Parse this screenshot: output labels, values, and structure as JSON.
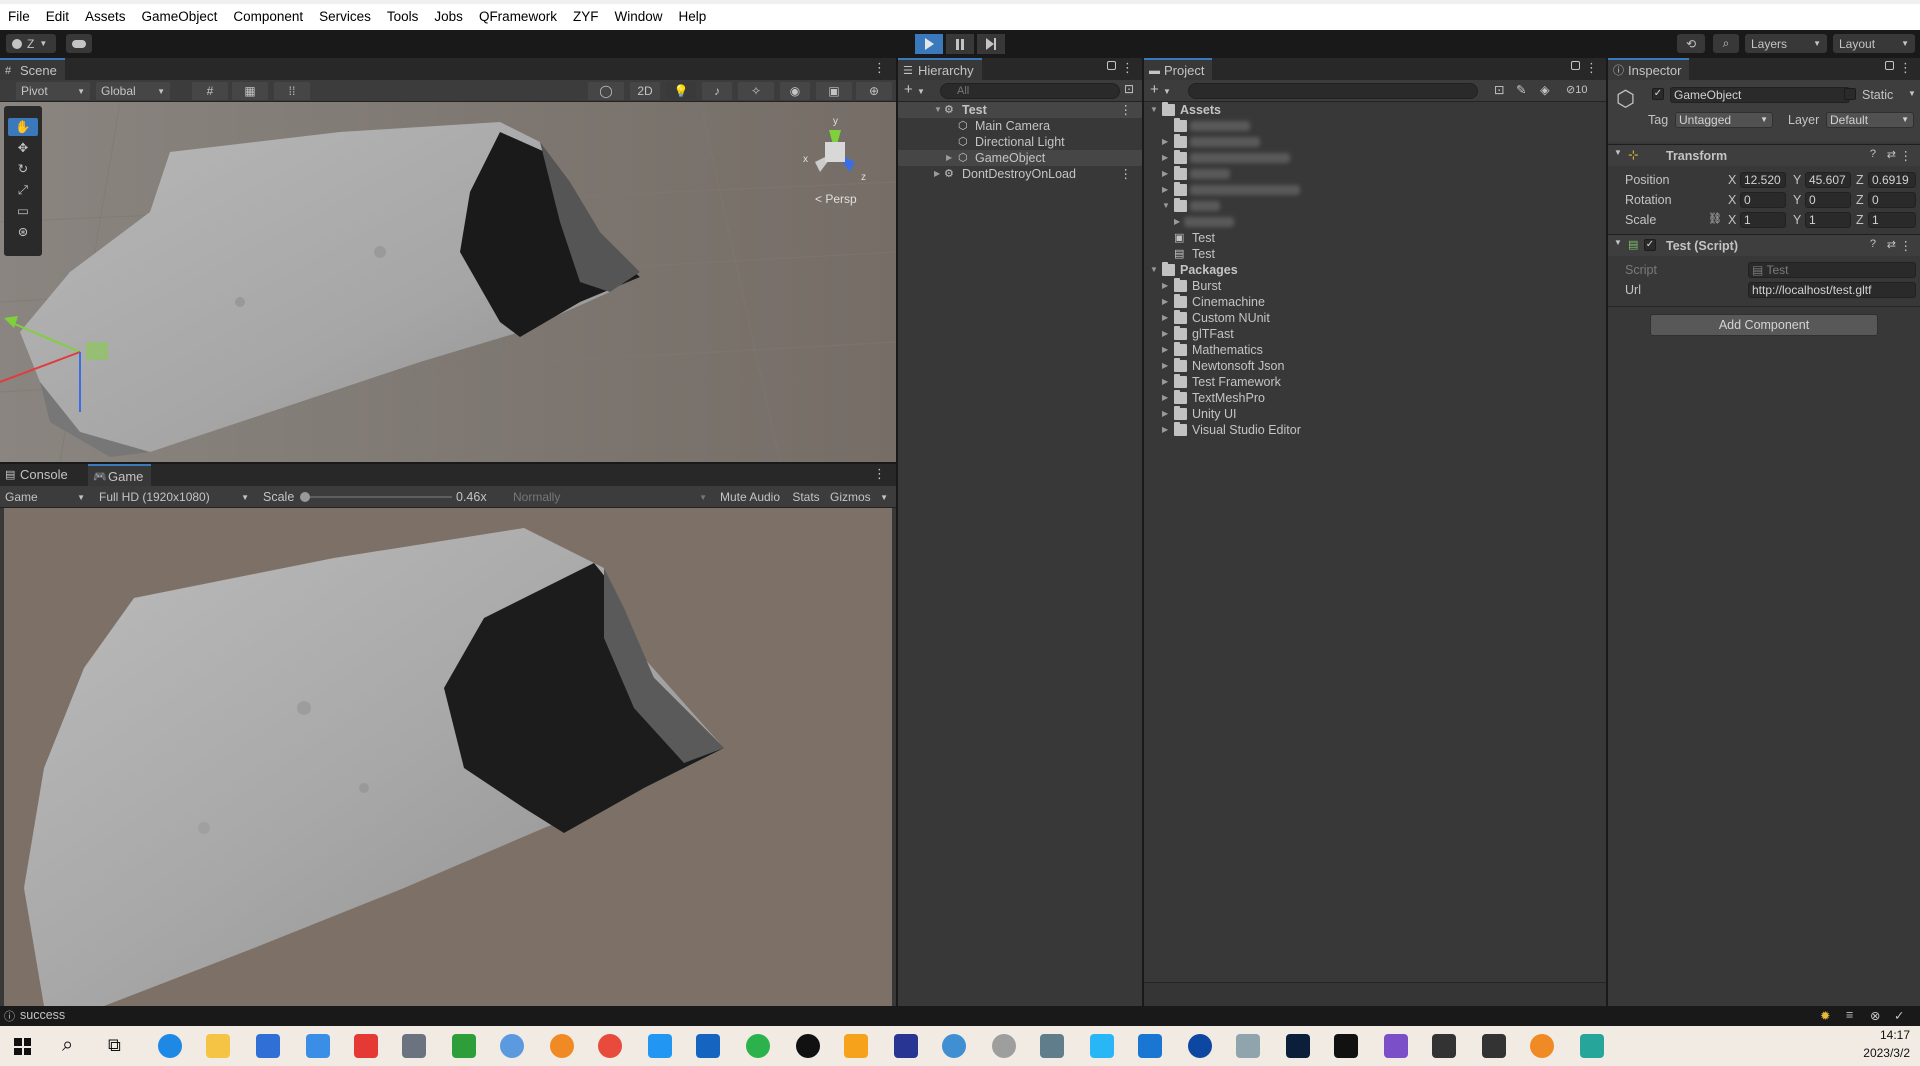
{
  "menu": [
    "File",
    "Edit",
    "Assets",
    "GameObject",
    "Component",
    "Services",
    "Tools",
    "Jobs",
    "QFramework",
    "ZYF",
    "Window",
    "Help"
  ],
  "toolbar": {
    "account_label": "Z",
    "layers_label": "Layers",
    "layout_label": "Layout"
  },
  "scene": {
    "tab_label": "Scene",
    "pivot_label": "Pivot",
    "global_label": "Global",
    "mode_2d_label": "2D",
    "persp_label": "< Persp",
    "gizmo_axes": {
      "y": "y",
      "x": "x",
      "z": "z"
    }
  },
  "game": {
    "console_tab_label": "Console",
    "game_tab_label": "Game",
    "display_label": "Game",
    "resolution_label": "Full HD (1920x1080)",
    "scale_label": "Scale",
    "scale_value": "0.46x",
    "scale_fraction": 0.02,
    "play_mode_label": "Normally",
    "mute_audio_label": "Mute Audio",
    "stats_label": "Stats",
    "gizmos_label": "Gizmos"
  },
  "hierarchy": {
    "tab_label": "Hierarchy",
    "search_placeholder": "All",
    "scene_name": "Test",
    "children": [
      "Main Camera",
      "Directional Light",
      "GameObject"
    ],
    "ddol_label": "DontDestroyOnLoad"
  },
  "project": {
    "tab_label": "Project",
    "hidden_count": "10",
    "assets_label": "Assets",
    "asset_files": [
      "Test",
      "Test"
    ],
    "packages_label": "Packages",
    "packages": [
      "Burst",
      "Cinemachine",
      "Custom NUnit",
      "glTFast",
      "Mathematics",
      "Newtonsoft Json",
      "Test Framework",
      "TextMeshPro",
      "Unity UI",
      "Visual Studio Editor"
    ]
  },
  "inspector": {
    "tab_label": "Inspector",
    "object_name": "GameObject",
    "static_label": "Static",
    "tag_label": "Tag",
    "tag_value": "Untagged",
    "layer_label": "Layer",
    "layer_value": "Default",
    "transform": {
      "title": "Transform",
      "position_label": "Position",
      "rotation_label": "Rotation",
      "scale_label": "Scale",
      "x_label": "X",
      "y_label": "Y",
      "z_label": "Z",
      "position": {
        "x": "12.520",
        "y": "45.607",
        "z": "0.6919"
      },
      "rotation": {
        "x": "0",
        "y": "0",
        "z": "0"
      },
      "scale": {
        "x": "1",
        "y": "1",
        "z": "1"
      }
    },
    "script_component": {
      "title": "Test (Script)",
      "script_label": "Script",
      "script_value": "Test",
      "url_label": "Url",
      "url_value": "http://localhost/test.gltf"
    },
    "add_component_label": "Add Component"
  },
  "status": {
    "message": "success"
  },
  "taskbar": {
    "time": "14:17",
    "date": "2023/3/2"
  },
  "colors": {
    "accent": "#3a79bb",
    "panel": "#383838",
    "game_background": "#7d7066"
  }
}
